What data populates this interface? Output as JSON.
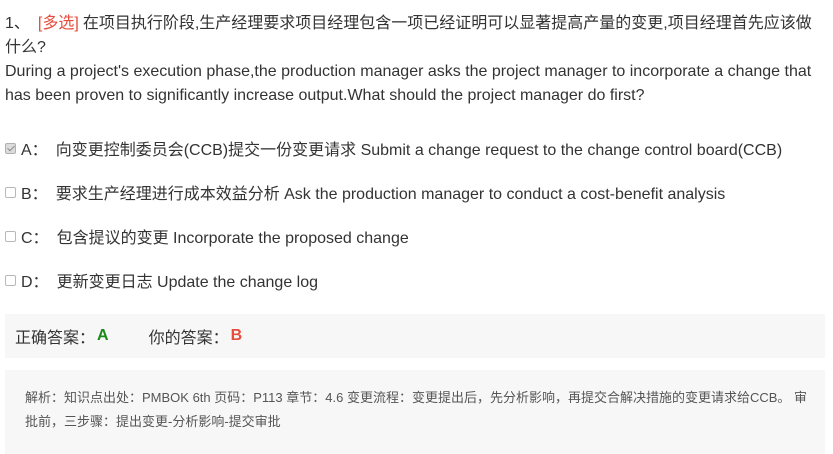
{
  "question": {
    "number": "1、",
    "type": "[多选]",
    "text_cn": "在项目执行阶段,生产经理要求项目经理包含一项已经证明可以显著提高产量的变更,项目经理首先应该做什么?",
    "text_en": "During a project's execution phase,the production manager asks the project manager to incorporate a change that has been proven to significantly increase output.What should the project manager do first?"
  },
  "options": [
    {
      "letter": "A：",
      "text": "向变更控制委员会(CCB)提交一份变更请求 Submit a change request to the change control board(CCB)",
      "checked": true
    },
    {
      "letter": "B：",
      "text": "要求生产经理进行成本效益分析 Ask the production manager to conduct a cost-benefit analysis",
      "checked": false
    },
    {
      "letter": "C：",
      "text": "包含提议的变更 Incorporate the proposed change",
      "checked": false
    },
    {
      "letter": "D：",
      "text": "更新变更日志 Update the change log",
      "checked": false
    }
  ],
  "answer": {
    "correct_label": "正确答案：",
    "correct_value": "A",
    "yours_label": "你的答案：",
    "yours_value": "B"
  },
  "analysis": {
    "text": "解析：知识点出处：PMBOK 6th 页码：P113 章节：4.6 变更流程：变更提出后，先分析影响，再提交合解决措施的变更请求给CCB。 审批前，三步骤：提出变更-分析影响-提交审批"
  },
  "colors": {
    "type_tag": "#e74c3c",
    "correct": "#1a8a1a",
    "wrong": "#e74c3c",
    "panel_bg": "#f7f7f7"
  }
}
